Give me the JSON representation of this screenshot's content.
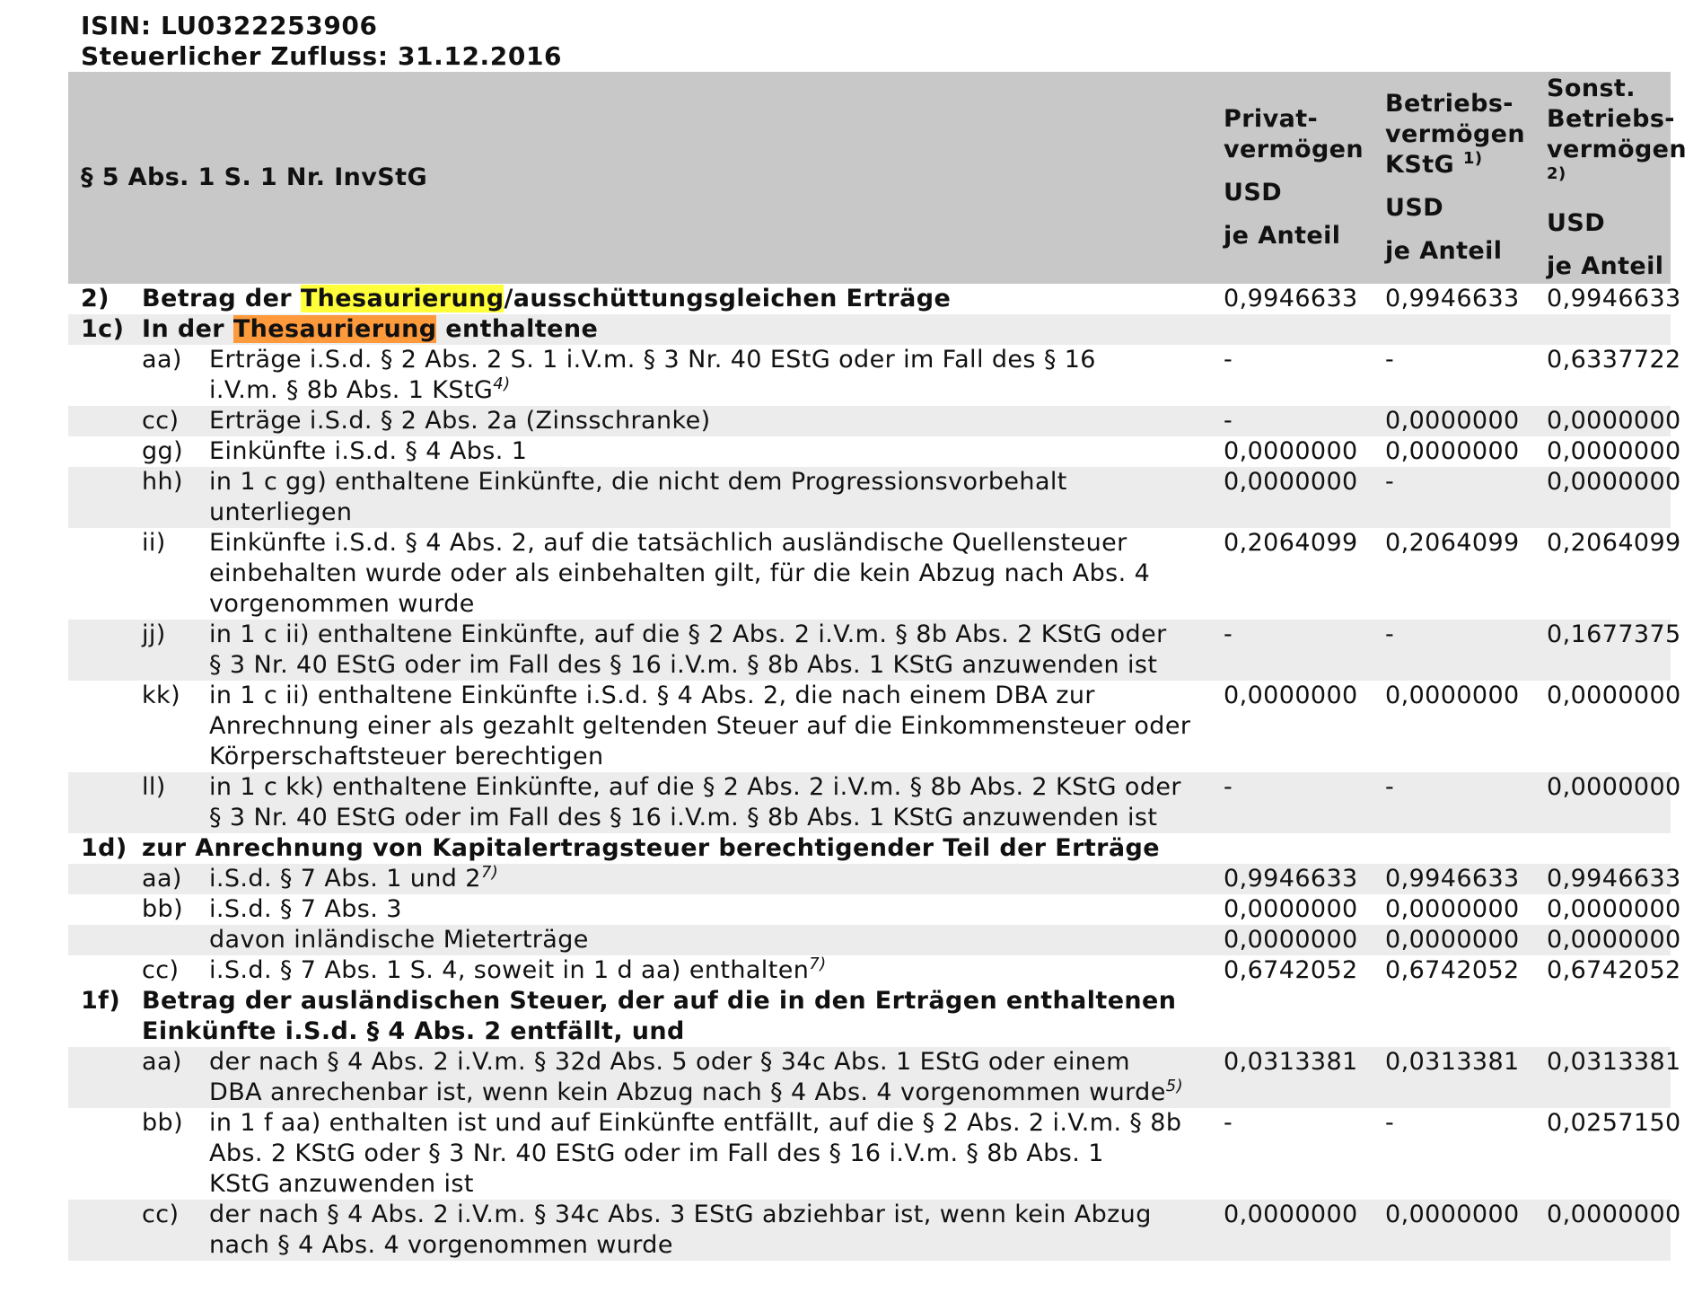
{
  "header": {
    "isin": "ISIN: LU0322253906",
    "zufluss": "Steuerlicher Zufluss: 31.12.2016"
  },
  "table_head": {
    "title": "§ 5 Abs. 1 S. 1 Nr. InvStG",
    "col1": {
      "l1": "Privat-",
      "l2": "vermögen",
      "l3": "USD",
      "l4": "je Anteil"
    },
    "col2": {
      "l1": "Betriebs-",
      "l2": "vermögen",
      "l3": "KStG",
      "sup": "1)",
      "l4": "USD",
      "l5": "je Anteil"
    },
    "col3": {
      "l1": "Sonst.",
      "l2": "Betriebs-",
      "l3": "vermögen",
      "sup": "2)",
      "l4": "USD",
      "l5": "je Anteil"
    }
  },
  "highlight_word": "Thesaurierung",
  "sections": {
    "s2": {
      "code": "2)",
      "pre": "Betrag der ",
      "post": "/ausschüttungsgleichen Erträge",
      "v": [
        "0,9946633",
        "0,9946633",
        "0,9946633"
      ]
    },
    "s1c": {
      "code": "1c)",
      "pre": "In der ",
      "post": " enthaltene"
    },
    "s1d": {
      "code": "1d)",
      "text": "zur Anrechnung von Kapitalertragsteuer berechtigender Teil der Erträge"
    },
    "s1f": {
      "code": "1f)",
      "line1": "Betrag der ausländischen Steuer, der auf die in den Erträgen enthaltenen",
      "line2": "Einkünfte i.S.d. § 4 Abs. 2 entfällt, und"
    }
  },
  "rows_1c": [
    {
      "sub": "aa)",
      "text": "Erträge i.S.d. § 2 Abs. 2 S. 1 i.V.m. § 3 Nr. 40 EStG oder im Fall des § 16",
      "text2": "i.V.m. § 8b Abs. 1 KStG",
      "sup": "4)",
      "v": [
        "-",
        "-",
        "0,6337722"
      ]
    },
    {
      "sub": "cc)",
      "text": "Erträge i.S.d. § 2 Abs. 2a (Zinsschranke)",
      "v": [
        "-",
        "0,0000000",
        "0,0000000"
      ]
    },
    {
      "sub": "gg)",
      "text": "Einkünfte i.S.d. § 4 Abs. 1",
      "v": [
        "0,0000000",
        "0,0000000",
        "0,0000000"
      ]
    },
    {
      "sub": "hh)",
      "text": "in 1 c gg) enthaltene Einkünfte, die nicht dem Progressionsvorbehalt",
      "text2": "unterliegen",
      "v": [
        "0,0000000",
        "-",
        "0,0000000"
      ]
    },
    {
      "sub": "ii)",
      "text": "Einkünfte i.S.d. § 4 Abs. 2, auf die tatsächlich ausländische Quellensteuer",
      "text2": "einbehalten wurde oder als einbehalten gilt, für die kein Abzug nach Abs. 4",
      "text3": "vorgenommen wurde",
      "v": [
        "0,2064099",
        "0,2064099",
        "0,2064099"
      ]
    },
    {
      "sub": "jj)",
      "text": "in 1 c ii) enthaltene Einkünfte, auf die § 2 Abs. 2 i.V.m. § 8b Abs. 2 KStG oder",
      "text2": "§ 3 Nr. 40 EStG oder im Fall des § 16 i.V.m. § 8b Abs. 1 KStG anzuwenden ist",
      "v": [
        "-",
        "-",
        "0,1677375"
      ]
    },
    {
      "sub": "kk)",
      "text": "in 1 c ii) enthaltene Einkünfte i.S.d. § 4 Abs. 2, die nach einem DBA zur",
      "text2": "Anrechnung einer als gezahlt geltenden Steuer auf die Einkommensteuer oder",
      "text3": "Körperschaftsteuer berechtigen",
      "v": [
        "0,0000000",
        "0,0000000",
        "0,0000000"
      ]
    },
    {
      "sub": "ll)",
      "text": "in 1 c kk) enthaltene Einkünfte, auf die § 2 Abs. 2 i.V.m. § 8b Abs. 2 KStG oder",
      "text2": "§ 3 Nr. 40 EStG oder im Fall des § 16 i.V.m. § 8b Abs. 1 KStG anzuwenden ist",
      "v": [
        "-",
        "-",
        "0,0000000"
      ]
    }
  ],
  "rows_1d": [
    {
      "sub": "aa)",
      "text": "i.S.d. § 7 Abs. 1 und 2",
      "sup": "7)",
      "v": [
        "0,9946633",
        "0,9946633",
        "0,9946633"
      ]
    },
    {
      "sub": "bb)",
      "text": "i.S.d. § 7 Abs. 3",
      "v": [
        "0,0000000",
        "0,0000000",
        "0,0000000"
      ]
    },
    {
      "sub": "",
      "text": "davon inländische Mieterträge",
      "v": [
        "0,0000000",
        "0,0000000",
        "0,0000000"
      ]
    },
    {
      "sub": "cc)",
      "text": "i.S.d. § 7 Abs. 1 S. 4, soweit in 1 d aa) enthalten",
      "sup": "7)",
      "v": [
        "0,6742052",
        "0,6742052",
        "0,6742052"
      ]
    }
  ],
  "rows_1f": [
    {
      "sub": "aa)",
      "text": "der nach § 4 Abs. 2 i.V.m. § 32d Abs. 5 oder § 34c Abs. 1 EStG oder einem",
      "text2": "DBA anrechenbar ist, wenn kein Abzug nach § 4 Abs. 4 vorgenommen wurde",
      "sup": "5)",
      "v": [
        "0,0313381",
        "0,0313381",
        "0,0313381"
      ]
    },
    {
      "sub": "bb)",
      "text": "in 1 f aa) enthalten ist und auf Einkünfte entfällt, auf die § 2 Abs. 2 i.V.m. § 8b",
      "text2": "Abs. 2 KStG oder § 3 Nr. 40 EStG oder im Fall des § 16 i.V.m. § 8b Abs. 1",
      "text3": "KStG anzuwenden ist",
      "v": [
        "-",
        "-",
        "0,0257150"
      ]
    },
    {
      "sub": "cc)",
      "text": "der nach § 4 Abs. 2 i.V.m. § 34c Abs. 3 EStG abziehbar ist, wenn kein Abzug",
      "text2": "nach § 4 Abs. 4 vorgenommen wurde",
      "v": [
        "0,0000000",
        "0,0000000",
        "0,0000000"
      ]
    }
  ]
}
